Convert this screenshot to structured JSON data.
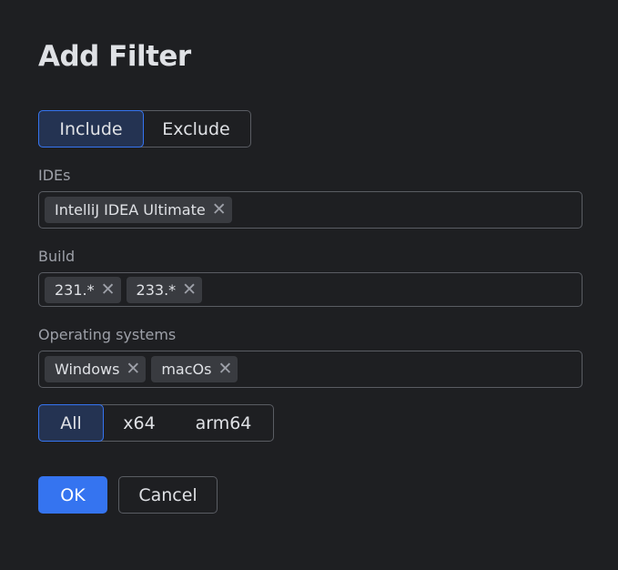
{
  "title": "Add Filter",
  "mode": {
    "options": [
      "Include",
      "Exclude"
    ],
    "selected": "Include"
  },
  "ides": {
    "label": "IDEs",
    "chips": [
      "IntelliJ IDEA Ultimate"
    ]
  },
  "build": {
    "label": "Build",
    "chips": [
      "231.*",
      "233.*"
    ]
  },
  "os": {
    "label": "Operating systems",
    "chips": [
      "Windows",
      "macOs"
    ]
  },
  "arch": {
    "options": [
      "All",
      "x64",
      "arm64"
    ],
    "selected": "All"
  },
  "buttons": {
    "ok": "OK",
    "cancel": "Cancel"
  },
  "colors": {
    "accent": "#3574f0",
    "background": "#1e1f22",
    "chip": "#393b40"
  }
}
